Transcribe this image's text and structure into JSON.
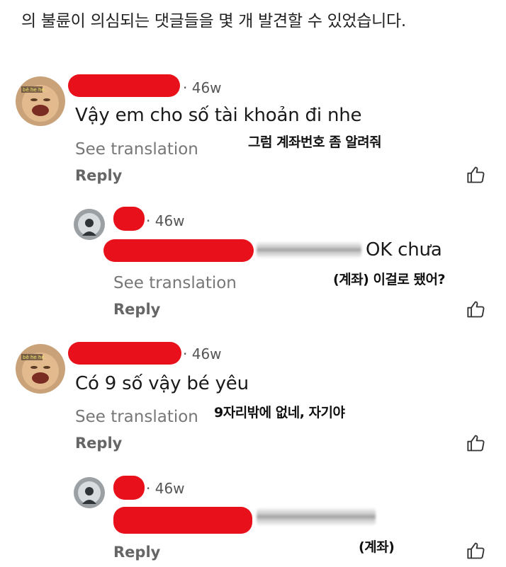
{
  "header": {
    "text": "의 불륜이 의심되는 댓글들을 몇 개 발견할 수 있었습니다."
  },
  "comments": [
    {
      "avatar_text": "bê he he..",
      "timestamp": "· 46w",
      "text": "Vậy em cho số tài khoản đi nhe",
      "see_translation": "See translation",
      "reply": "Reply",
      "annotation": "그럼 계좌번호 좀 알려줘"
    },
    {
      "timestamp": "· 46w",
      "text": "OK chưa",
      "see_translation": "See translation",
      "reply": "Reply",
      "annotation": "(계좌) 이걸로 됐어?"
    },
    {
      "avatar_text": "bê he he..",
      "timestamp": "· 46w",
      "text": "Có 9 số vậy bé yêu",
      "see_translation": "See translation",
      "reply": "Reply",
      "annotation": "9자리밖에 없네, 자기야"
    },
    {
      "timestamp": "· 46w",
      "reply": "Reply",
      "annotation": "(계좌)"
    }
  ],
  "icons": {
    "like": "thumbs-up-icon",
    "avatar_baby": "baby-face-avatar",
    "avatar_dark": "dark-profile-avatar"
  },
  "colors": {
    "redaction": "#e8101b",
    "text": "#1a1a1a",
    "muted": "#777777"
  }
}
